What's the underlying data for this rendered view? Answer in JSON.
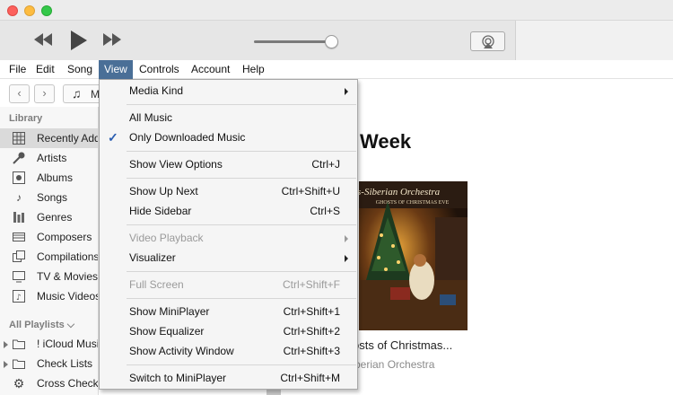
{
  "menubar": {
    "items": [
      {
        "label": "File"
      },
      {
        "label": "Edit"
      },
      {
        "label": "Song"
      },
      {
        "label": "View"
      },
      {
        "label": "Controls"
      },
      {
        "label": "Account"
      },
      {
        "label": "Help"
      }
    ],
    "active": "View"
  },
  "transport": {
    "volume_level": 0.92
  },
  "nav": {
    "media_label": "M"
  },
  "sidebar": {
    "library_title": "Library",
    "library_items": [
      {
        "label": "Recently Added",
        "icon": "grid-icon",
        "selected": true
      },
      {
        "label": "Artists",
        "icon": "microphone-icon"
      },
      {
        "label": "Albums",
        "icon": "album-icon"
      },
      {
        "label": "Songs",
        "icon": "music-note-icon"
      },
      {
        "label": "Genres",
        "icon": "genres-icon"
      },
      {
        "label": "Composers",
        "icon": "composers-icon"
      },
      {
        "label": "Compilations",
        "icon": "compilations-icon"
      },
      {
        "label": "TV & Movies",
        "icon": "tv-icon"
      },
      {
        "label": "Music Videos",
        "icon": "music-video-icon"
      }
    ],
    "playlists_title": "All Playlists ⌵",
    "playlist_items": [
      {
        "label": "! iCloud Music",
        "icon": "folder-icon"
      },
      {
        "label": "Check Lists",
        "icon": "folder-icon"
      },
      {
        "label": "Cross Checks",
        "icon": "gear-icon"
      }
    ]
  },
  "main": {
    "heading": "Week",
    "album": {
      "title": "osts of Christmas...",
      "artist": "berian Orchestra",
      "cover_text_top": "s-Siberian Orchestra",
      "cover_text_sub": "GHOSTS OF CHRISTMAS EVE"
    }
  },
  "view_menu": {
    "items": [
      {
        "label": "Media Kind",
        "submenu": true
      },
      {
        "separator": true
      },
      {
        "label": "All Music"
      },
      {
        "label": "Only Downloaded Music",
        "checked": true
      },
      {
        "separator": true
      },
      {
        "label": "Show View Options",
        "shortcut": "Ctrl+J"
      },
      {
        "separator": true
      },
      {
        "label": "Show Up Next",
        "shortcut": "Ctrl+Shift+U"
      },
      {
        "label": "Hide Sidebar",
        "shortcut": "Ctrl+S"
      },
      {
        "separator": true
      },
      {
        "label": "Video Playback",
        "submenu": true,
        "disabled": true
      },
      {
        "label": "Visualizer",
        "submenu": true
      },
      {
        "separator": true
      },
      {
        "label": "Full Screen",
        "shortcut": "Ctrl+Shift+F",
        "disabled": true
      },
      {
        "separator": true
      },
      {
        "label": "Show MiniPlayer",
        "shortcut": "Ctrl+Shift+1"
      },
      {
        "label": "Show Equalizer",
        "shortcut": "Ctrl+Shift+2"
      },
      {
        "label": "Show Activity Window",
        "shortcut": "Ctrl+Shift+3"
      },
      {
        "separator": true
      },
      {
        "label": "Switch to MiniPlayer",
        "shortcut": "Ctrl+Shift+M"
      }
    ]
  },
  "colors": {
    "menu_highlight": "#4a6f97",
    "check": "#2a5db0"
  }
}
